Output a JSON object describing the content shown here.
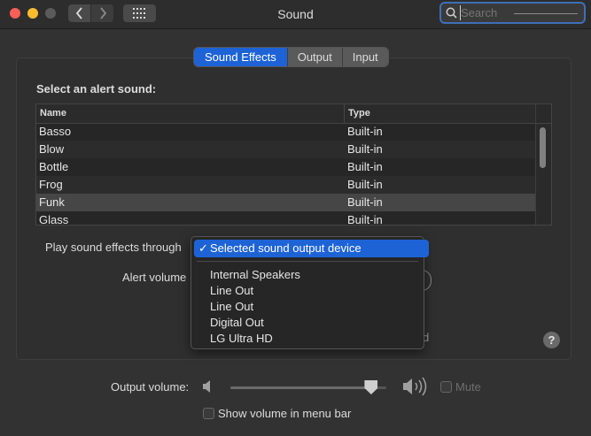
{
  "window": {
    "title": "Sound"
  },
  "search": {
    "placeholder": "Search"
  },
  "tabs": [
    {
      "label": "Sound Effects",
      "active": true
    },
    {
      "label": "Output",
      "active": false
    },
    {
      "label": "Input",
      "active": false
    }
  ],
  "sound_effects": {
    "alert_label": "Select an alert sound:",
    "columns": {
      "name": "Name",
      "type": "Type"
    },
    "rows": [
      {
        "name": "Basso",
        "type": "Built-in"
      },
      {
        "name": "Blow",
        "type": "Built-in"
      },
      {
        "name": "Bottle",
        "type": "Built-in"
      },
      {
        "name": "Frog",
        "type": "Built-in"
      },
      {
        "name": "Funk",
        "type": "Built-in",
        "selected": true
      },
      {
        "name": "Glass",
        "type": "Built-in"
      }
    ],
    "play_through_label": "Play sound effects through",
    "alert_volume_label": "Alert volume",
    "obscured_text": "d",
    "help": "?"
  },
  "output_menu": {
    "checkmark": "✓",
    "selected": "Selected sound output device",
    "items": [
      "Internal Speakers",
      "Line Out",
      "Line Out",
      "Digital Out",
      "LG Ultra HD"
    ]
  },
  "output_volume": {
    "label": "Output volume:",
    "level": 0.9,
    "mute_label": "Mute",
    "mute_checked": false,
    "menubar_label": "Show volume in menu bar",
    "menubar_checked": false
  },
  "colors": {
    "accent": "#1e63d6",
    "background": "#323232"
  },
  "icons": [
    "chevron-left-icon",
    "chevron-right-icon",
    "grid-icon",
    "search-icon",
    "speaker-low-icon",
    "speaker-high-icon"
  ]
}
